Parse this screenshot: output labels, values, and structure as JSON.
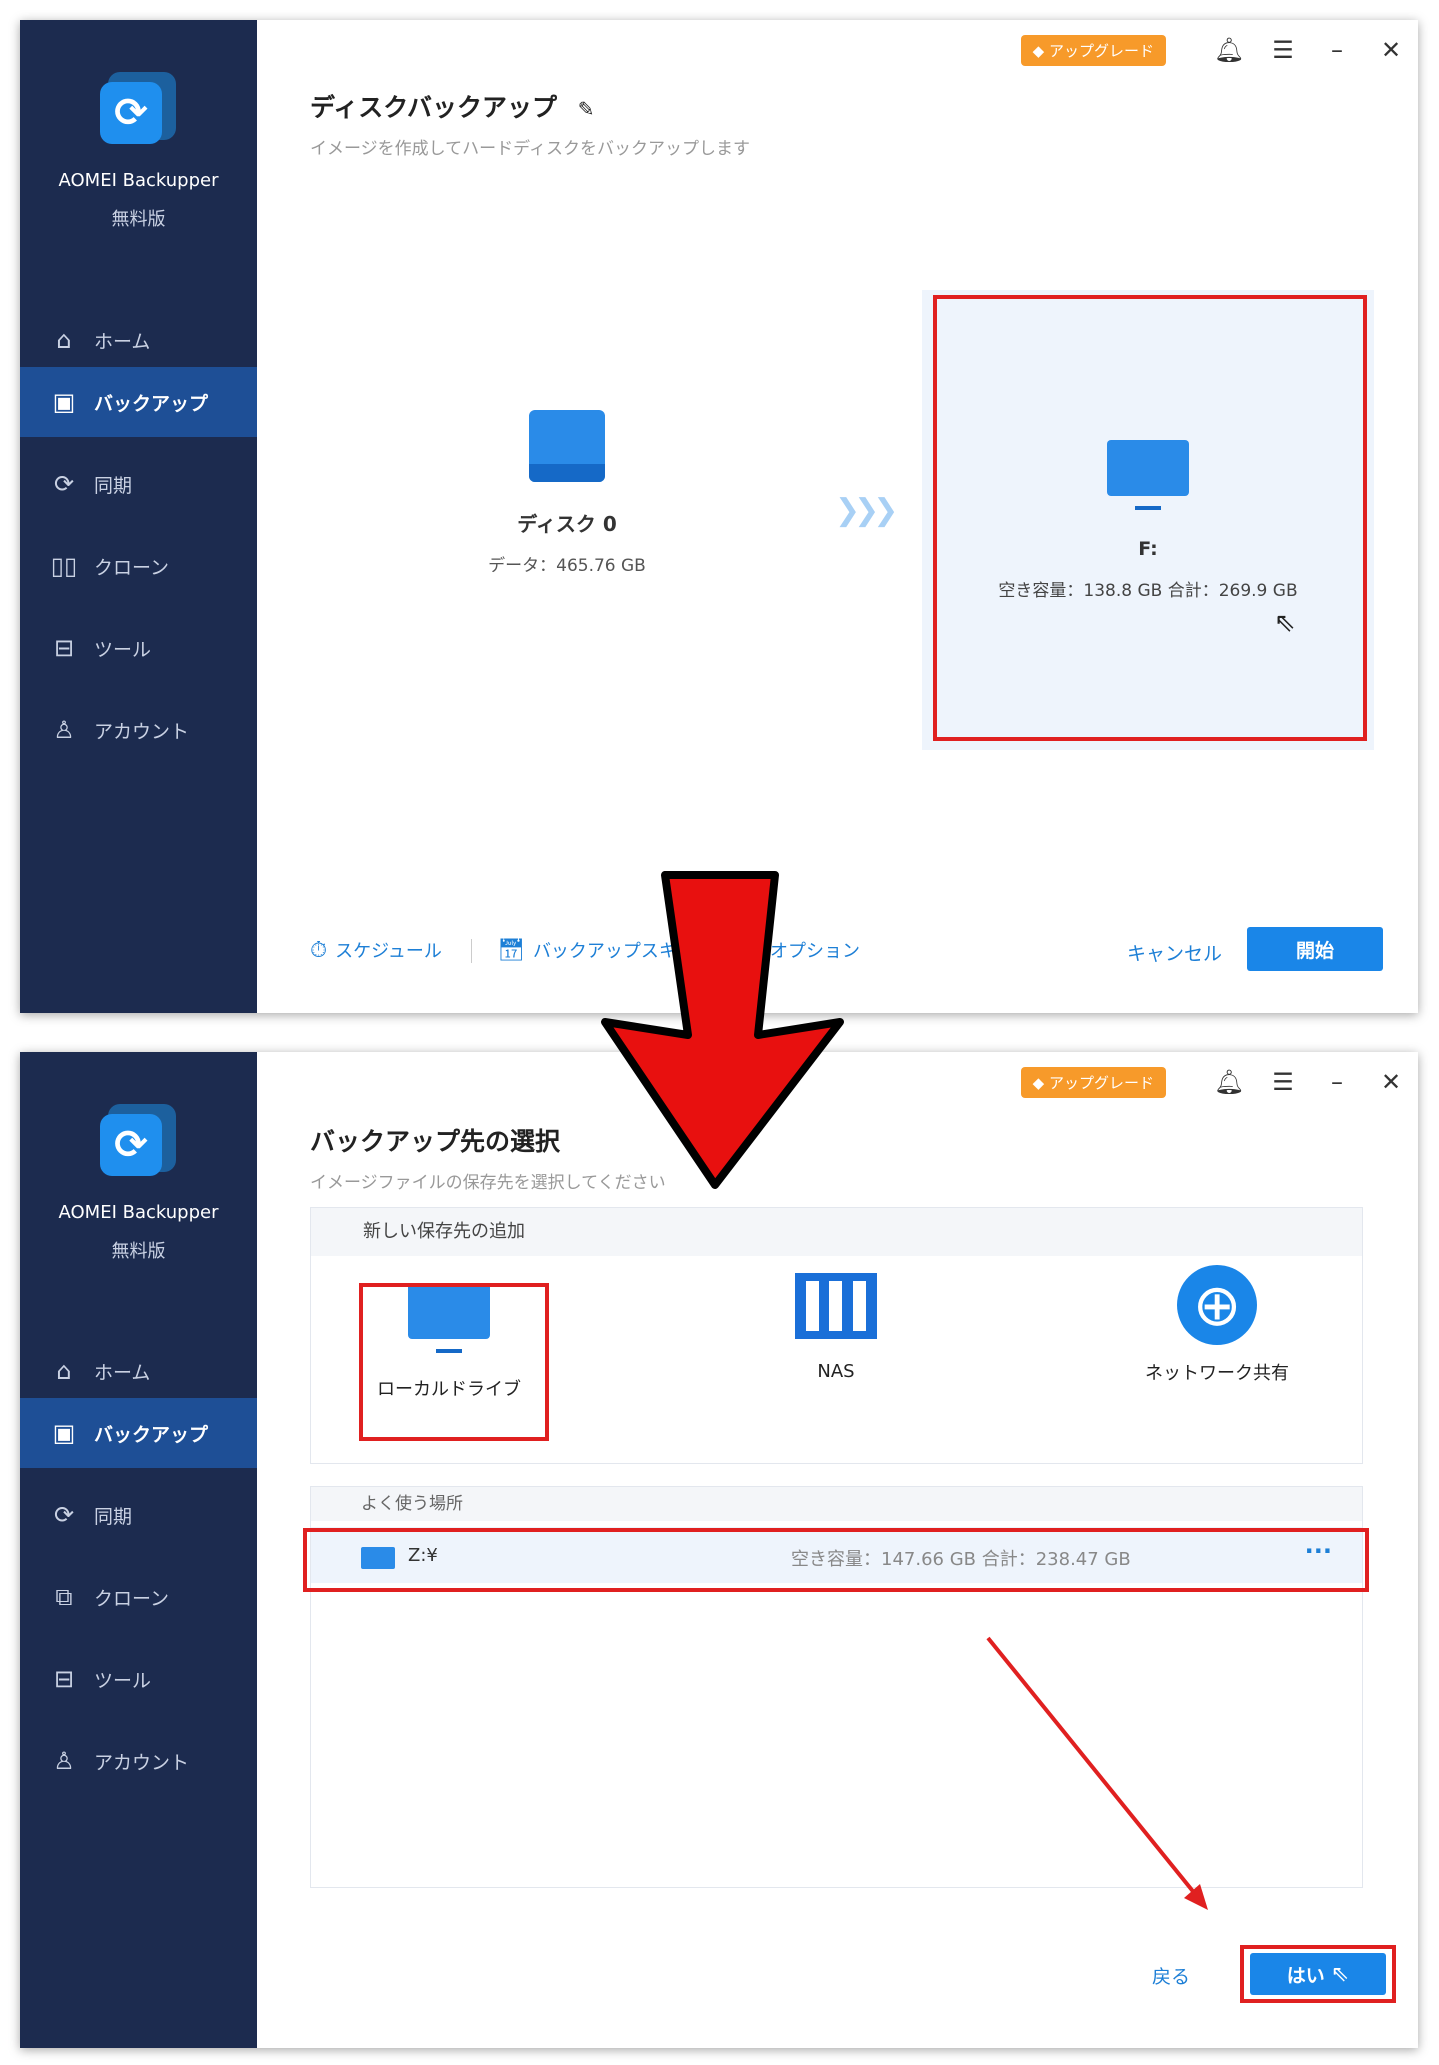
{
  "app": {
    "name": "AOMEI Backupper",
    "edition": "無料版"
  },
  "topbar": {
    "upgrade_label": "アップグレード"
  },
  "nav": {
    "home": "ホーム",
    "backup": "バックアップ",
    "sync": "同期",
    "clone": "クローン",
    "tools": "ツール",
    "account": "アカウント"
  },
  "screen1": {
    "title": "ディスクバックアップ",
    "subtitle": "イメージを作成してハードディスクをバックアップします",
    "source": {
      "name": "ディスク 0",
      "info": "データ：465.76 GB"
    },
    "destination": {
      "name": "F:",
      "info": "空き容量：138.8 GB 合計：269.9 GB"
    },
    "footer": {
      "schedule": "スケジュール",
      "scheme": "バックアップスキー",
      "options": "オプション",
      "cancel": "キャンセル",
      "start": "開始"
    }
  },
  "screen2": {
    "title": "バックアップ先の選択",
    "subtitle": "イメージファイルの保存先を選択してください",
    "add_new_header": "新しい保存先の追加",
    "options": [
      {
        "label": "ローカルドライブ",
        "icon": "monitor-icon"
      },
      {
        "label": "NAS",
        "icon": "nas-icon"
      },
      {
        "label": "ネットワーク共有",
        "icon": "globe-icon"
      }
    ],
    "favorites_header": "よく使う場所",
    "favorites": [
      {
        "name": "Z:¥",
        "info": "空き容量：147.66 GB 合計：238.47 GB"
      }
    ],
    "footer": {
      "back": "戻る",
      "yes": "はい"
    }
  },
  "colors": {
    "sidebar": "#1c2b4f",
    "active_nav": "#1e4f96",
    "accent": "#1a86e8",
    "upgrade": "#f79a2a",
    "highlight": "#e02020"
  }
}
